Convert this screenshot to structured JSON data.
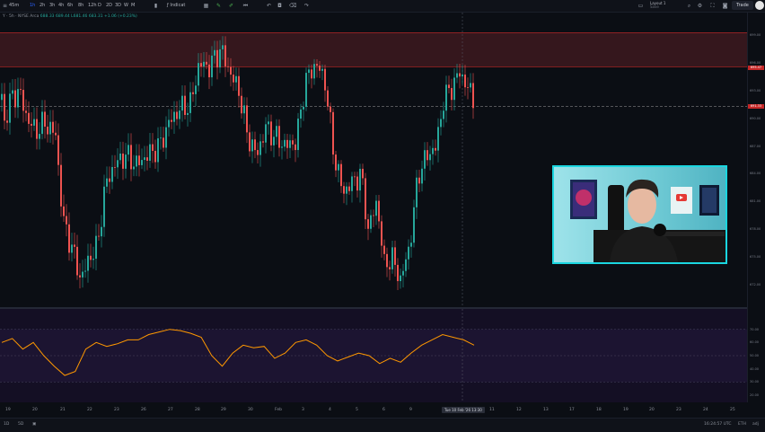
{
  "toolbar": {
    "timeframes": [
      "45m",
      "1h",
      "2h",
      "3h",
      "4h",
      "6h",
      "8h",
      "12h",
      "D",
      "2D",
      "3D",
      "W",
      "M"
    ],
    "indicators_label": "Indicat",
    "layout_label": "Layout 1",
    "layout_sublabel": "Save",
    "trade_label": "Trade",
    "icons": [
      "menu-icon",
      "chevron-down-icon",
      "candles-icon",
      "indicators-icon",
      "pencil-icon",
      "brush-icon",
      "alert-icon",
      "replay-icon",
      "undo-icon",
      "redo-icon",
      "fullscreen-icon",
      "camera-icon",
      "settings-icon",
      "search-icon"
    ]
  },
  "legend": {
    "symbol": "Y · 5h · NYSE Arca",
    "values": "688.33 689.44 L681.46 683.31 +1.06 (+0.23%)"
  },
  "chart_data": [
    {
      "type": "candlestick",
      "title": "",
      "x_labels": [
        "19",
        "20",
        "21",
        "22",
        "23",
        "26",
        "27",
        "28",
        "29",
        "30",
        "Feb",
        "3",
        "4",
        "5",
        "6",
        "9",
        "11",
        "12",
        "13",
        "17",
        "18",
        "19",
        "20",
        "23",
        "24",
        "25"
      ],
      "crosshair_label": "Tue 10 Feb '26 13:30",
      "y_ticks": [
        "699.00",
        "696.00",
        "693.00",
        "690.00",
        "687.00",
        "684.00",
        "681.00",
        "678.00",
        "675.00",
        "672.00"
      ],
      "price_tags": [
        {
          "value": "695.47",
          "color": "#c62828"
        },
        {
          "value": "691.33",
          "color": "#c62828"
        }
      ],
      "colors": {
        "up": "#26a69a",
        "down": "#ef5350",
        "resistance_zone": "#5a1f24"
      }
    },
    {
      "type": "line",
      "title": "",
      "series": [
        {
          "values": [
            60,
            63,
            55,
            60,
            50,
            42,
            35,
            38,
            55,
            60,
            57,
            59,
            62,
            62,
            66,
            68,
            70,
            69,
            67,
            64,
            50,
            42,
            52,
            58,
            56,
            57,
            48,
            52,
            60,
            62,
            58,
            50,
            46,
            49,
            52,
            50,
            44,
            48,
            45,
            52,
            58,
            62,
            66,
            64,
            62,
            58
          ]
        }
      ],
      "ylim": [
        20,
        80
      ],
      "y_ticks": [
        "70.00",
        "60.00",
        "50.00",
        "40.00",
        "30.00",
        "20.00"
      ],
      "colors": {
        "line": "#ff9800",
        "band": "#1d1533"
      }
    }
  ],
  "bottom": {
    "left_labels": [
      "1D",
      "5D"
    ],
    "clock": "16:24:57 UTC",
    "mode_labels": [
      "ETH",
      "adj",
      "%",
      "log",
      "auto"
    ]
  }
}
